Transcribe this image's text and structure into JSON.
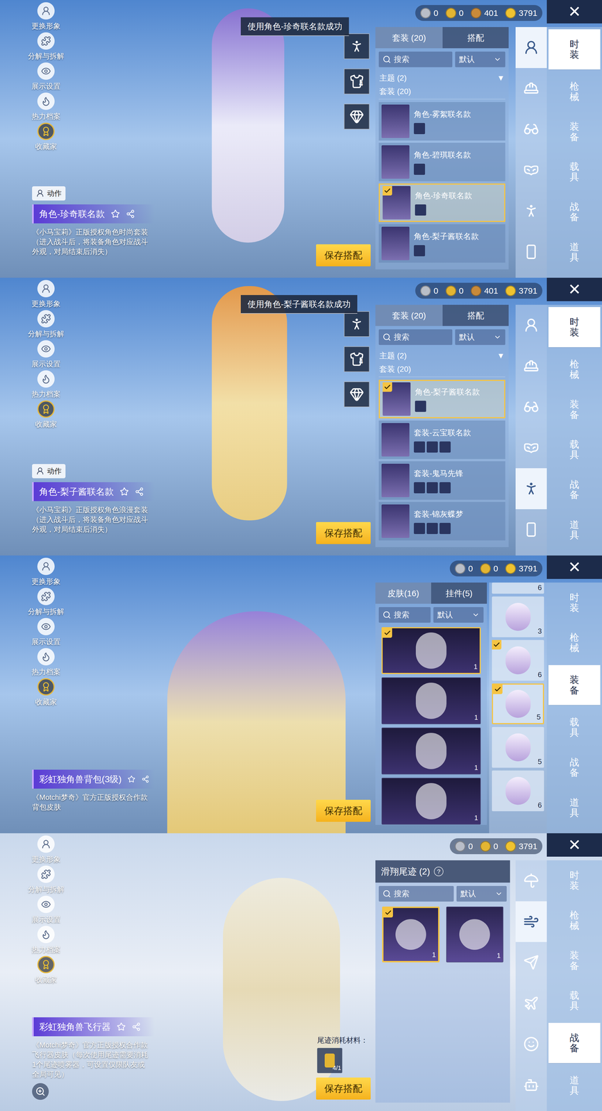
{
  "panels": [
    {
      "kind": "outfit",
      "toast": "使用角色-珍奇联名款成功",
      "currencies": [
        {
          "value": "0",
          "color": "#b9bec8"
        },
        {
          "value": "0",
          "color": "#e3b532"
        },
        {
          "value": "401",
          "color": "#c98a3a"
        },
        {
          "value": "3791",
          "color": "#f0c330"
        }
      ],
      "close": "✕",
      "menu": [
        "更换形象",
        "分解与拆解",
        "展示设置",
        "热力档案",
        "收藏家"
      ],
      "action": "动作",
      "title": "角色-珍奇联名款",
      "description": "《小马宝莉》正版授权角色时尚套装（进入战斗后，将装备角色对应战斗外观，对局结束后消失）",
      "save": "保存搭配",
      "tools": [
        {},
        {
          "badge": "4"
        },
        {}
      ],
      "tabs": [
        {
          "label": "套装 (20)",
          "selected": true
        },
        {
          "label": "搭配",
          "selected": false
        }
      ],
      "search": {
        "placeholder": "搜索"
      },
      "sort": "默认",
      "filter": {
        "label": "主题 (2)",
        "arrow": "▼"
      },
      "section": "套装 (20)",
      "entries": [
        {
          "name": "角色-雾絮联名款",
          "selected": false,
          "equipped": false,
          "parts": 1
        },
        {
          "name": "角色-碧琪联名款",
          "selected": false,
          "equipped": false,
          "parts": 1
        },
        {
          "name": "角色-珍奇联名款",
          "selected": true,
          "equipped": true,
          "parts": 1
        },
        {
          "name": "角色-梨子酱联名款",
          "selected": false,
          "equipped": false,
          "parts": 1
        }
      ],
      "slots": [
        {
          "selected": true
        },
        {
          "selected": false
        },
        {
          "selected": false
        },
        {
          "selected": false
        },
        {
          "selected": false
        },
        {
          "selected": false
        }
      ],
      "categories": [
        {
          "label": "时装",
          "selected": true
        },
        {
          "label": "枪械",
          "selected": false
        },
        {
          "label": "装备",
          "selected": false
        },
        {
          "label": "载具",
          "selected": false
        },
        {
          "label": "战备",
          "selected": false
        },
        {
          "label": "道具",
          "selected": false
        }
      ]
    },
    {
      "kind": "outfit",
      "toast": "使用角色-梨子酱联名款成功",
      "currencies": [
        {
          "value": "0",
          "color": "#b9bec8"
        },
        {
          "value": "0",
          "color": "#e3b532"
        },
        {
          "value": "401",
          "color": "#c98a3a"
        },
        {
          "value": "3791",
          "color": "#f0c330"
        }
      ],
      "close": "✕",
      "menu": [
        "更换形象",
        "分解与拆解",
        "展示设置",
        "热力档案",
        "收藏家"
      ],
      "action": "动作",
      "title": "角色-梨子酱联名款",
      "description": "《小马宝莉》正版授权角色浪漫套装（进入战斗后，将装备角色对应战斗外观，对局结束后消失）",
      "save": "保存搭配",
      "tools": [
        {},
        {
          "badge": "4"
        },
        {}
      ],
      "tabs": [
        {
          "label": "套装 (20)",
          "selected": true
        },
        {
          "label": "搭配",
          "selected": false
        }
      ],
      "search": {
        "placeholder": "搜索"
      },
      "sort": "默认",
      "filter": {
        "label": "主题 (2)",
        "arrow": "▼"
      },
      "section": "套装 (20)",
      "entries": [
        {
          "name": "角色-梨子酱联名款",
          "selected": true,
          "equipped": true,
          "parts": 1
        },
        {
          "name": "套装-云宝联名款",
          "selected": false,
          "equipped": false,
          "parts": 3
        },
        {
          "name": "套装-鬼马先锋",
          "selected": false,
          "equipped": false,
          "parts": 3
        },
        {
          "name": "套装-锦灰蝶梦",
          "selected": false,
          "equipped": false,
          "parts": 3
        }
      ],
      "slots": [
        {
          "selected": false
        },
        {
          "selected": false
        },
        {
          "selected": false
        },
        {
          "selected": false
        },
        {
          "selected": true
        },
        {
          "selected": false
        }
      ],
      "categories": [
        {
          "label": "时装",
          "selected": true
        },
        {
          "label": "枪械",
          "selected": false
        },
        {
          "label": "装备",
          "selected": false
        },
        {
          "label": "载具",
          "selected": false
        },
        {
          "label": "战备",
          "selected": false
        },
        {
          "label": "道具",
          "selected": false
        }
      ]
    },
    {
      "kind": "equipment",
      "currencies": [
        {
          "value": "0",
          "color": "#b9bec8"
        },
        {
          "value": "0",
          "color": "#e3b532"
        },
        {
          "value": "3791",
          "color": "#f0c330"
        }
      ],
      "close": "✕",
      "menu": [
        "更换形象",
        "分解与拆解",
        "展示设置",
        "热力档案",
        "收藏家"
      ],
      "title": "彩虹独角兽背包(3级)",
      "description": "《Motchi梦奇》官方正版授权合作款背包皮肤",
      "save": "保存搭配",
      "tabs": [
        {
          "label": "皮肤(16)",
          "selected": true
        },
        {
          "label": "挂件(5)",
          "selected": false
        }
      ],
      "search": {
        "placeholder": "搜索"
      },
      "sort": "默认",
      "skins": [
        {
          "count": "1",
          "selected": true,
          "equipped": true
        },
        {
          "count": "1",
          "selected": false,
          "equipped": false
        },
        {
          "count": "1",
          "selected": false,
          "equipped": false
        },
        {
          "count": "1",
          "selected": false,
          "equipped": false
        }
      ],
      "gear": [
        {
          "kind": "cut",
          "count": "6",
          "selected": false,
          "equipped": false
        },
        {
          "kind": "full",
          "count": "3",
          "selected": false,
          "equipped": false
        },
        {
          "kind": "full",
          "count": "6",
          "selected": false,
          "equipped": true
        },
        {
          "kind": "full",
          "count": "5",
          "selected": true,
          "equipped": true
        },
        {
          "kind": "full",
          "count": "5",
          "selected": false,
          "equipped": false
        },
        {
          "kind": "full",
          "count": "6",
          "selected": false,
          "equipped": false
        }
      ],
      "categories": [
        {
          "label": "时装",
          "selected": false
        },
        {
          "label": "枪械",
          "selected": false
        },
        {
          "label": "装备",
          "selected": true
        },
        {
          "label": "载具",
          "selected": false
        },
        {
          "label": "战备",
          "selected": false
        },
        {
          "label": "道具",
          "selected": false
        }
      ]
    },
    {
      "kind": "vehicle",
      "currencies": [
        {
          "value": "0",
          "color": "#b9bec8"
        },
        {
          "value": "0",
          "color": "#e3b532"
        },
        {
          "value": "3791",
          "color": "#f0c330"
        }
      ],
      "close": "✕",
      "menu": [
        "更换形象",
        "分解与拆解",
        "展示设置",
        "热力档案",
        "收藏家"
      ],
      "title": "彩虹独角兽飞行器",
      "description": "《Motchi梦奇》官方正版授权合作款飞行器皮肤（每次使用尾迹需要消耗1个尾迹喷雾器，可设置仅限队友或全局可见）",
      "save": "保存搭配",
      "material": {
        "label": "尾迹消耗材料：",
        "count": "4/1"
      },
      "heading": "滑翔尾迹 (2)",
      "help": "?",
      "search": {
        "placeholder": "搜索"
      },
      "sort": "默认",
      "trails": [
        {
          "count": "1",
          "selected": true,
          "equipped": true
        },
        {
          "count": "1",
          "selected": false,
          "equipped": false
        }
      ],
      "slots": [
        {
          "selected": false
        },
        {
          "selected": true
        },
        {
          "selected": false
        },
        {
          "selected": false
        },
        {
          "selected": false
        },
        {
          "selected": false
        }
      ],
      "categories": [
        {
          "label": "时装",
          "selected": false
        },
        {
          "label": "枪械",
          "selected": false
        },
        {
          "label": "装备",
          "selected": false
        },
        {
          "label": "载具",
          "selected": false
        },
        {
          "label": "战备",
          "selected": true
        },
        {
          "label": "道具",
          "selected": false
        }
      ]
    }
  ]
}
